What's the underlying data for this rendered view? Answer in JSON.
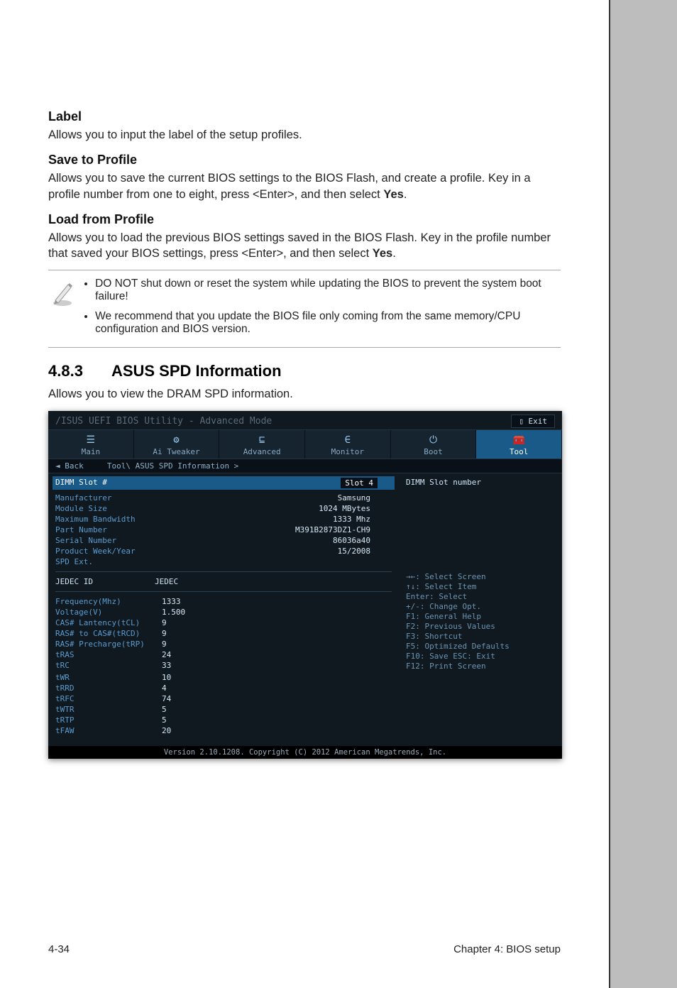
{
  "sections": {
    "label_heading": "Label",
    "label_text": "Allows you to input the label of the setup profiles.",
    "save_heading": "Save to Profile",
    "save_text_1": "Allows you to save the current BIOS settings to the BIOS Flash, and create a profile. Key in a profile number from one to eight, press <Enter>, and then select ",
    "save_text_bold": "Yes",
    "save_text_2": ".",
    "load_heading": "Load from Profile",
    "load_text_1": "Allows you to load the previous BIOS settings saved in the BIOS Flash. Key in the profile number that saved your BIOS settings, press <Enter>, and then select ",
    "load_text_bold": "Yes",
    "load_text_2": "."
  },
  "notes": {
    "item1": "DO NOT shut down or reset the system while updating the BIOS to prevent the system boot failure!",
    "item2": "We recommend that you update the BIOS file only coming from the same memory/CPU configuration and BIOS version."
  },
  "section483": {
    "num": "4.8.3",
    "title": "ASUS SPD Information",
    "desc": "Allows you to view the DRAM SPD information."
  },
  "bios": {
    "titlebar": "/ISUS UEFI BIOS Utility - Advanced Mode",
    "exit": "Exit",
    "tabs": {
      "main": "Main",
      "ai": "Ai Tweaker",
      "advanced": "Advanced",
      "monitor": "Monitor",
      "boot": "Boot",
      "tool": "Tool"
    },
    "back": "Back",
    "breadcrumb": "Tool\\ ASUS SPD Information >",
    "dimm_slot_label": "DIMM Slot #",
    "dimm_slot_value": "Slot 4",
    "right_heading": "DIMM Slot number",
    "info": [
      {
        "lbl": "Manufacturer",
        "val": "Samsung"
      },
      {
        "lbl": "Module Size",
        "val": "1024 MBytes"
      },
      {
        "lbl": "Maximum Bandwidth",
        "val": "1333 Mhz"
      },
      {
        "lbl": "Part Number",
        "val": "M391B2873DZ1-CH9"
      },
      {
        "lbl": "Serial Number",
        "val": "86036a40"
      },
      {
        "lbl": "Product Week/Year",
        "val": "15/2008"
      },
      {
        "lbl": "SPD Ext.",
        "val": ""
      }
    ],
    "jedec_hdr_lbl": "JEDEC ID",
    "jedec_hdr_val": "JEDEC",
    "timings": [
      {
        "lbl": "Frequency(Mhz)",
        "val": "1333"
      },
      {
        "lbl": "Voltage(V)",
        "val": "1.500"
      },
      {
        "lbl": "CAS# Lantency(tCL)",
        "val": "9"
      },
      {
        "lbl": "RAS# to CAS#(tRCD)",
        "val": "9"
      },
      {
        "lbl": "RAS# Precharge(tRP)",
        "val": "9"
      },
      {
        "lbl": "tRAS",
        "val": "24"
      },
      {
        "lbl": "tRC",
        "val": "33"
      },
      {
        "lbl": "",
        "val": ""
      },
      {
        "lbl": "tWR",
        "val": "10"
      },
      {
        "lbl": "tRRD",
        "val": "4"
      },
      {
        "lbl": "tRFC",
        "val": "74"
      },
      {
        "lbl": "tWTR",
        "val": "5"
      },
      {
        "lbl": "tRTP",
        "val": "5"
      },
      {
        "lbl": "tFAW",
        "val": "20"
      }
    ],
    "keyhelp": [
      "→←: Select Screen",
      "↑↓: Select Item",
      "Enter: Select",
      "+/-: Change Opt.",
      "F1: General Help",
      "F2: Previous Values",
      "F3: Shortcut",
      "F5: Optimized Defaults",
      "F10: Save  ESC: Exit",
      "F12: Print Screen"
    ],
    "footer": "Version 2.10.1208. Copyright (C) 2012 American Megatrends, Inc."
  },
  "pagefoot": {
    "left": "4-34",
    "right": "Chapter 4: BIOS setup"
  }
}
